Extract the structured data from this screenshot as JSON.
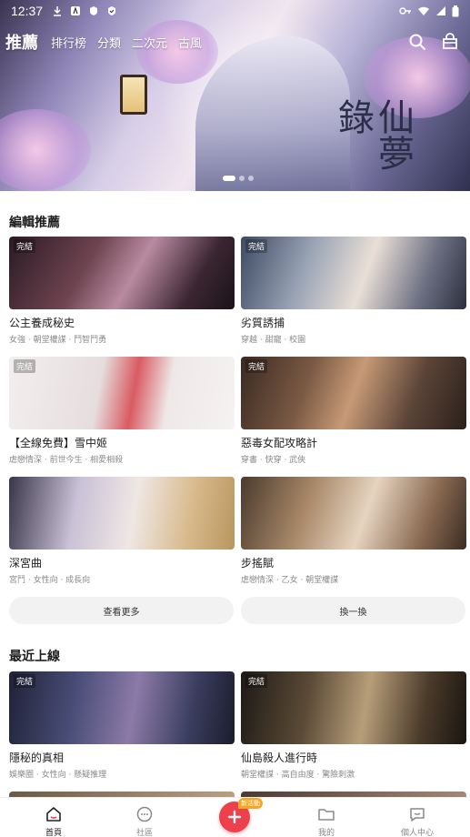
{
  "status_bar": {
    "time": "12:37"
  },
  "top_nav": {
    "tabs": [
      {
        "label": "推薦",
        "active": true
      },
      {
        "label": "排行榜"
      },
      {
        "label": "分類"
      },
      {
        "label": "二次元"
      },
      {
        "label": "古風"
      }
    ],
    "icons": [
      "search-icon",
      "bag-icon"
    ]
  },
  "banner": {
    "art_title": "仙夢錄",
    "slide_count": 3,
    "active_slide": 1
  },
  "editor_picks": {
    "title": "編輯推薦",
    "items": [
      {
        "badge": "完結",
        "title": "公主養成秘史",
        "tags": "女強 · 朝堂權謀 · 鬥智鬥勇"
      },
      {
        "badge": "完結",
        "title": "劣質誘捕",
        "tags": "穿越 · 甜寵 · 校園"
      },
      {
        "badge": "完結",
        "title": "【全線免費】雪中姬",
        "tags": "虐戀情深 · 前世今生 · 相愛相殺"
      },
      {
        "badge": "完結",
        "title": "惡毒女配攻略計",
        "tags": "穿書 · 快穿 · 武俠"
      },
      {
        "badge": "",
        "title": "深宮曲",
        "tags": "宮鬥 · 女性向 · 成長向"
      },
      {
        "badge": "",
        "title": "步搖賦",
        "tags": "虐戀情深 · 乙女 · 朝堂權謀"
      }
    ],
    "more_label": "查看更多",
    "refresh_label": "換一換"
  },
  "recent": {
    "title": "最近上線",
    "items": [
      {
        "badge": "完結",
        "title": "隱秘的真相",
        "tags": "娛樂圈 · 女性向 · 懸疑推理"
      },
      {
        "badge": "完結",
        "title": "仙島殺人進行時",
        "tags": "朝堂權謀 · 高自由度 · 驚險刺激"
      }
    ]
  },
  "tab_bar": {
    "items": [
      {
        "label": "首頁",
        "icon": "home-icon",
        "active": true
      },
      {
        "label": "社區",
        "icon": "chat-bubble-icon"
      },
      {
        "label": "我的",
        "icon": "folder-icon"
      },
      {
        "label": "個人中心",
        "icon": "smile-bubble-icon"
      }
    ],
    "create_badge": "新活動",
    "create_icon": "plus-icon"
  },
  "colors": {
    "accent": "#ee3f4d",
    "badge_orange": "#f5a623",
    "text_primary": "#222222",
    "text_secondary": "#8a8a8a"
  }
}
